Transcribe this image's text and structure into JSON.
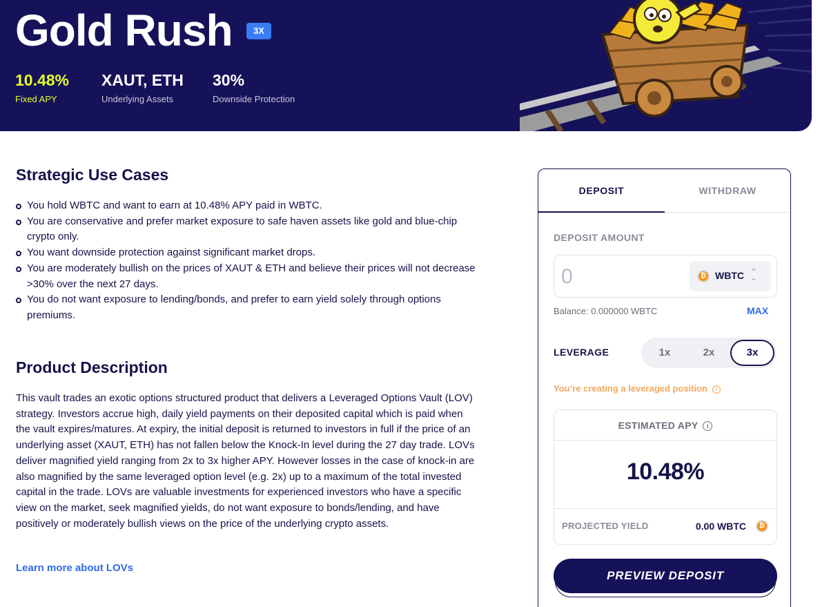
{
  "hero": {
    "title": "Gold Rush",
    "leverage_badge": "3X",
    "stats": [
      {
        "value": "10.48%",
        "label": "Fixed APY"
      },
      {
        "value": "XAUT, ETH",
        "label": "Underlying Assets"
      },
      {
        "value": "30%",
        "label": "Downside Protection"
      }
    ],
    "apy_color": "#e6ff2a",
    "background_color": "#15125a"
  },
  "use_cases": {
    "heading": "Strategic Use Cases",
    "items": [
      "You hold WBTC and want to earn at 10.48% APY paid in WBTC.",
      "You are conservative and prefer market exposure to safe haven assets like gold and blue-chip crypto only.",
      "You want downside protection against significant market drops.",
      "You are moderately bullish on the prices of XAUT & ETH and believe their prices will not decrease >30% over the next 27 days.",
      "You do not want exposure to lending/bonds, and prefer to earn yield solely through options premiums."
    ]
  },
  "product": {
    "heading": "Product Description",
    "description": "This vault trades an exotic options structured product that delivers a Leveraged Options Vault (LOV) strategy. Investors accrue high, daily yield payments on their deposited capital which is paid when the vault expires/matures. At expiry, the initial deposit is returned to investors in full if the price of an underlying asset (XAUT, ETH) has not fallen below the Knock-In level during the 27 day trade. LOVs deliver magnified yield ranging from 2x to 3x higher APY. However losses in the case of knock-in are also magnified by the same leveraged option level (e.g. 2x) up to a maximum of the total invested capital in the trade. LOVs are valuable investments for experienced investors who have a specific view on the market, seek magnified yields, do not want exposure to bonds/lending, and have positively or moderately bullish views on the price of the underlying crypto assets.",
    "learn_more": "Learn more about LOVs"
  },
  "panel": {
    "tabs": [
      "DEPOSIT",
      "WITHDRAW"
    ],
    "active_tab": "DEPOSIT",
    "deposit_label": "DEPOSIT AMOUNT",
    "amount_placeholder": "0",
    "token": "WBTC",
    "token_icon": "bitcoin-icon",
    "balance": "Balance: 0.000000 WBTC",
    "max_label": "MAX",
    "leverage_label": "LEVERAGE",
    "leverage_options": [
      "1x",
      "2x",
      "3x"
    ],
    "leverage_selected": "3x",
    "leverage_warning": "You’re creating a leveraged position",
    "warning_color": "#f4a65c",
    "estimated_apy_label": "ESTIMATED APY",
    "estimated_apy": "10.48%",
    "projected_yield_label": "PROJECTED YIELD",
    "projected_yield": "0.00 WBTC",
    "preview_button": "PREVIEW DEPOSIT",
    "accent_color": "#2f6be8"
  }
}
